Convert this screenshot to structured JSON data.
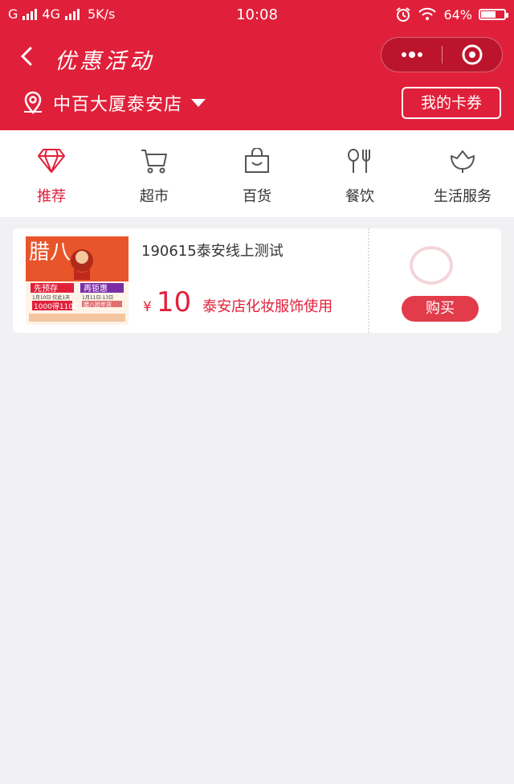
{
  "status_bar": {
    "carrier1": "G",
    "network": "4G",
    "speed": "5K/s",
    "time": "10:08",
    "battery": "64%",
    "battery_level": 0.64,
    "icons": [
      "signal-icon",
      "alarm-icon",
      "wifi-icon",
      "battery-icon"
    ]
  },
  "nav": {
    "title": "优惠活动",
    "back_icon": "back-arrow-icon",
    "capsule_icons": [
      "more-dots-icon",
      "close-target-icon"
    ]
  },
  "store": {
    "name": "中百大厦泰安店",
    "icon": "location-pin-icon",
    "dropdown_icon": "caret-down-icon",
    "my_cards_label": "我的卡券"
  },
  "categories": [
    {
      "label": "推荐",
      "icon": "diamond-icon",
      "active": true
    },
    {
      "label": "超市",
      "icon": "cart-icon",
      "active": false
    },
    {
      "label": "百货",
      "icon": "shopping-bag-icon",
      "active": false
    },
    {
      "label": "餐饮",
      "icon": "utensils-icon",
      "active": false
    },
    {
      "label": "生活服务",
      "icon": "lotus-icon",
      "active": false
    }
  ],
  "coupon": {
    "title": "190615泰安线上测试",
    "currency": "¥",
    "amount": "10",
    "description": "泰安店化妆服饰使用",
    "buy_label": "购买",
    "thumb_texts": {
      "main": "腊八",
      "left_tag": "先预存",
      "right_tag": "再钜惠",
      "date_left": "1月10日 仅此1天",
      "offer_left": "1000得1100",
      "date_right": "1月11日-13日",
      "offer_right": "腊八抢年货"
    }
  },
  "colors": {
    "brand_red": "#e0203a",
    "background": "#f1f1f3",
    "buy_button": "#e23b4a"
  }
}
